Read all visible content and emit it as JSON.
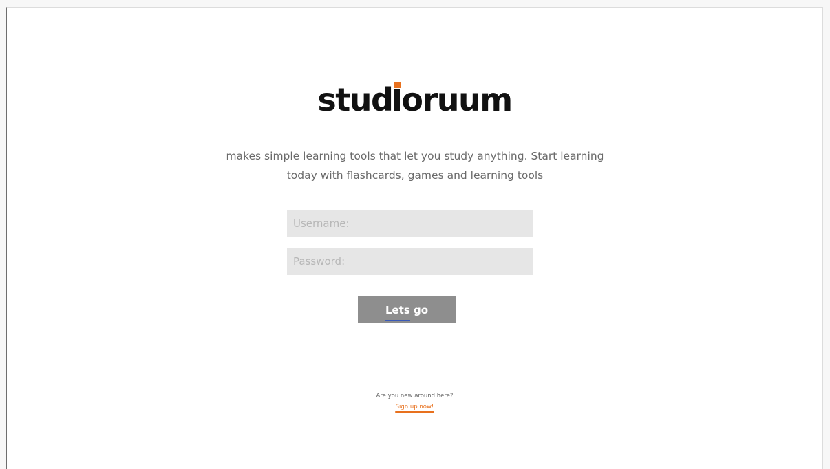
{
  "brand": {
    "logo_text_before": "stud",
    "logo_text_after": "oruum",
    "dot_color": "#e8711e"
  },
  "tagline": {
    "line1": "makes simple learning tools that let you study anything. Start learning",
    "line2": "today with flashcards, games and learning tools"
  },
  "form": {
    "username_placeholder": "Username:",
    "password_placeholder": "Password:",
    "submit_label_underlined": "Lets",
    "submit_label_rest": " go"
  },
  "signup": {
    "prompt": "Are you new around here?",
    "link_label": "Sign up now!"
  }
}
